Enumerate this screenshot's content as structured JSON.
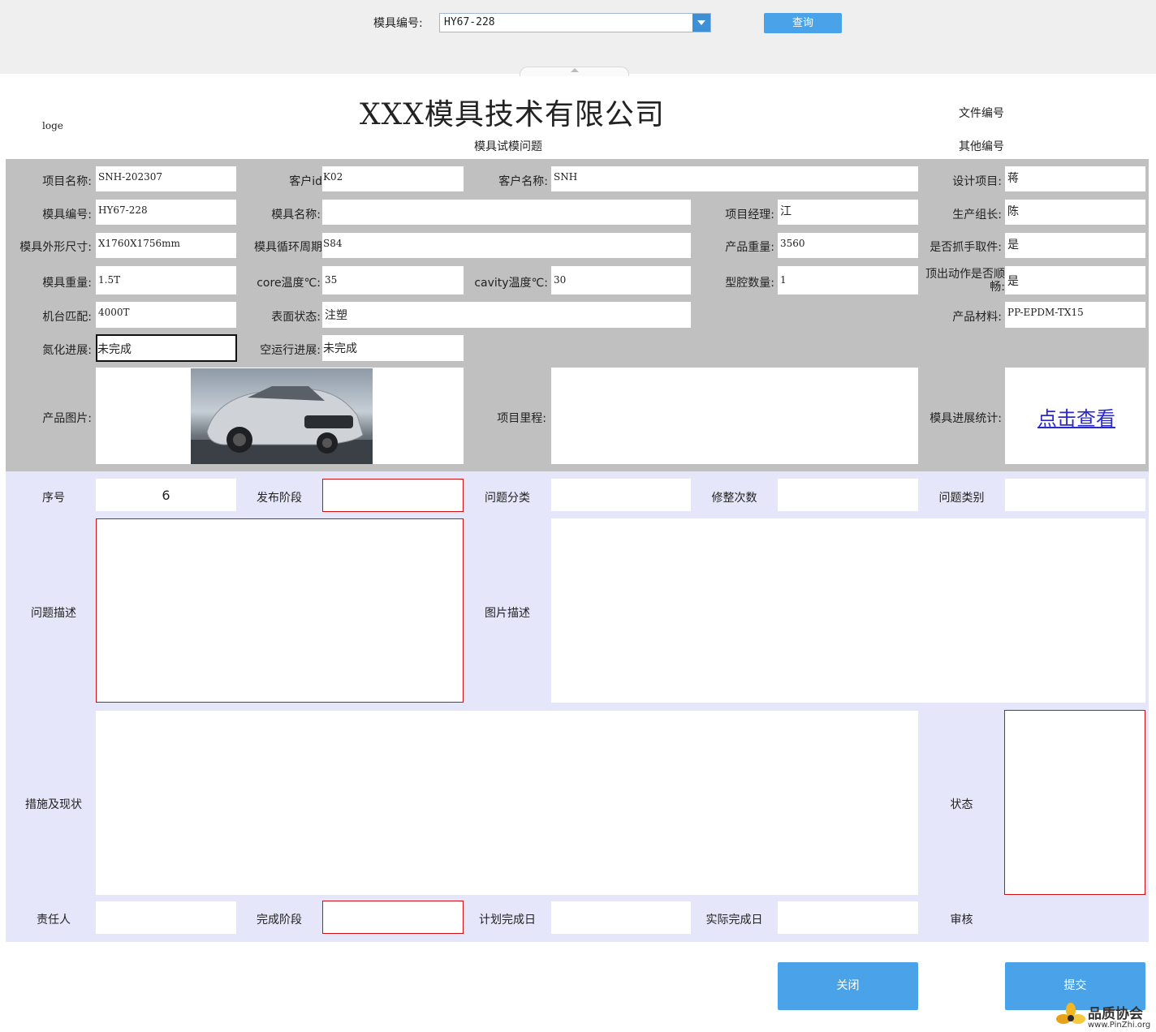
{
  "topbar": {
    "mold_label": "模具编号:",
    "mold_value": "HY67-228",
    "query_label": "查询"
  },
  "header": {
    "logo": "loge",
    "company": "XXX模具技术有限公司",
    "subtitle": "模具试模问题",
    "doc_no": "文件编号",
    "other_no": "其他编号"
  },
  "info": {
    "project_name": {
      "label": "项目名称:",
      "value": "SNH-202307"
    },
    "customer_id": {
      "label": "客户id",
      "value": "K02"
    },
    "customer_name": {
      "label": "客户名称:",
      "value": "SNH"
    },
    "design_project": {
      "label": "设计项目:",
      "value": "蒋"
    },
    "mold_no": {
      "label": "模具编号:",
      "value": "HY67-228"
    },
    "mold_name": {
      "label": "模具名称:",
      "value": ""
    },
    "project_manager": {
      "label": "项目经理:",
      "value": "江"
    },
    "production_leader": {
      "label": "生产组长:",
      "value": "陈"
    },
    "mold_size": {
      "label": "模具外形尺寸:",
      "value": "X1760X1756mm"
    },
    "cycle_time": {
      "label": "模具循环周期",
      "value": "S84"
    },
    "product_weight": {
      "label": "产品重量:",
      "value": "3560"
    },
    "gripper": {
      "label": "是否抓手取件:",
      "value": "是"
    },
    "mold_weight": {
      "label": "模具重量:",
      "value": "1.5T"
    },
    "core_temp": {
      "label": "core温度℃:",
      "value": "35"
    },
    "cavity_temp": {
      "label": "cavity温度℃:",
      "value": "30"
    },
    "cavity_count": {
      "label": "型腔数量:",
      "value": "1"
    },
    "ejection_smooth": {
      "label": "顶出动作是否顺畅:",
      "value": "是"
    },
    "machine": {
      "label": "机台匹配:",
      "value": "4000T"
    },
    "surface": {
      "label": "表面状态:",
      "value": "注塑"
    },
    "material": {
      "label": "产品材料:",
      "value": "PP-EPDM-TX15"
    },
    "nitriding": {
      "label": "氮化进展:",
      "value": "未完成"
    },
    "dry_run": {
      "label": "空运行进展:",
      "value": "未完成"
    },
    "product_image": {
      "label": "产品图片:"
    },
    "milestone": {
      "label": "项目里程:",
      "value": ""
    },
    "progress_stats": {
      "label": "模具进展统计:",
      "link": "点击查看"
    }
  },
  "issue": {
    "seq": {
      "label": "序号",
      "value": "6"
    },
    "release_stage": {
      "label": "发布阶段",
      "value": ""
    },
    "category": {
      "label": "问题分类",
      "value": ""
    },
    "rework_count": {
      "label": "修整次数",
      "value": ""
    },
    "issue_type": {
      "label": "问题类别",
      "value": ""
    },
    "description": {
      "label": "问题描述",
      "value": ""
    },
    "image_desc": {
      "label": "图片描述",
      "value": ""
    },
    "measures": {
      "label": "措施及现状",
      "value": ""
    },
    "status": {
      "label": "状态",
      "value": ""
    },
    "owner": {
      "label": "责任人",
      "value": ""
    },
    "complete_stage": {
      "label": "完成阶段",
      "value": ""
    },
    "planned_date": {
      "label": "计划完成日",
      "value": ""
    },
    "actual_date": {
      "label": "实际完成日",
      "value": ""
    },
    "review": {
      "label": "审核"
    }
  },
  "buttons": {
    "close": "关闭",
    "submit": "提交"
  },
  "watermark": {
    "text": "品质协会",
    "url": "www.PinZhi.org"
  }
}
